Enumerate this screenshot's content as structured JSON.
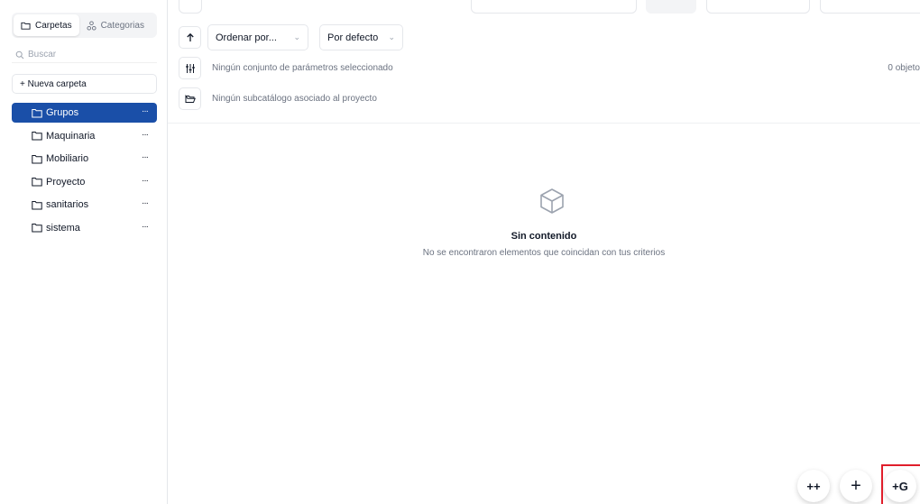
{
  "sidebar": {
    "tabs": [
      {
        "label": "Carpetas",
        "icon": "folder-icon",
        "active": true
      },
      {
        "label": "Categorias",
        "icon": "categories-icon",
        "active": false
      }
    ],
    "search": {
      "placeholder": "Buscar"
    },
    "new_folder_label": "+ Nueva carpeta",
    "folders": [
      {
        "label": "Grupos",
        "active": true
      },
      {
        "label": "Maquinaria",
        "active": false
      },
      {
        "label": "Mobiliario",
        "active": false
      },
      {
        "label": "Proyecto",
        "active": false
      },
      {
        "label": "sanitarios",
        "active": false
      },
      {
        "label": "sistema",
        "active": false
      }
    ],
    "more_label": "···"
  },
  "toolbar": {
    "sort_select": {
      "value": "Ordenar por..."
    },
    "order_select": {
      "value": "Por defecto"
    },
    "params_text": "Ningún conjunto de parámetros seleccionado",
    "subcatalog_text": "Ningún subcatálogo asociado al proyecto",
    "count": "0 objeto"
  },
  "empty_state": {
    "title": "Sin contenido",
    "subtitle": "No se encontraron elementos que coincidan con tus criterios"
  },
  "fabs": [
    {
      "label": "++"
    },
    {
      "label": "+"
    },
    {
      "label": "+G"
    }
  ],
  "colors": {
    "accent": "#1a4fa8",
    "highlight": "#e01e2b"
  }
}
